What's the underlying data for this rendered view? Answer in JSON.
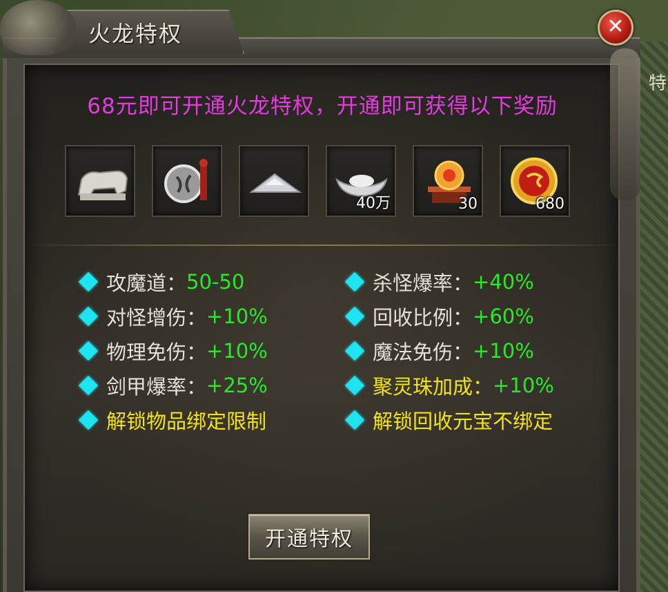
{
  "background": {
    "side_char": "特"
  },
  "dialog": {
    "title": "火龙特权",
    "close_icon": "close-icon"
  },
  "headline": "68元即可开通火龙特权，开通即可获得以下奖励",
  "rewards": [
    {
      "icon": "stone-beast-icon",
      "count": ""
    },
    {
      "icon": "medallion-icon",
      "count": ""
    },
    {
      "icon": "silver-pile-icon",
      "count": ""
    },
    {
      "icon": "silver-ingot-icon",
      "count": "40万"
    },
    {
      "icon": "fire-orb-icon",
      "count": "30"
    },
    {
      "icon": "gold-coin-icon",
      "count": "680"
    }
  ],
  "stats_left": [
    {
      "label": "攻魔道：",
      "value": "50-50"
    },
    {
      "label": "对怪增伤：",
      "value": "+10%"
    },
    {
      "label": "物理免伤：",
      "value": "+10%"
    },
    {
      "label": "剑甲爆率：",
      "value": "+25%"
    },
    {
      "label": "解锁物品绑定限制",
      "value": ""
    }
  ],
  "stats_right": [
    {
      "label": "杀怪爆率：",
      "value": "+40%"
    },
    {
      "label": "回收比例：",
      "value": "+60%"
    },
    {
      "label": "魔法免伤：",
      "value": "+10%"
    },
    {
      "label": "聚灵珠加成：",
      "value": "+10%"
    },
    {
      "label": "解锁回收元宝不绑定",
      "value": ""
    }
  ],
  "colors": {
    "headline": "#e23be0",
    "stat_value": "#27ea27",
    "unlock_text": "#f2e21a",
    "bullet": "#1de4f0"
  },
  "button": {
    "label": "开通特权"
  }
}
